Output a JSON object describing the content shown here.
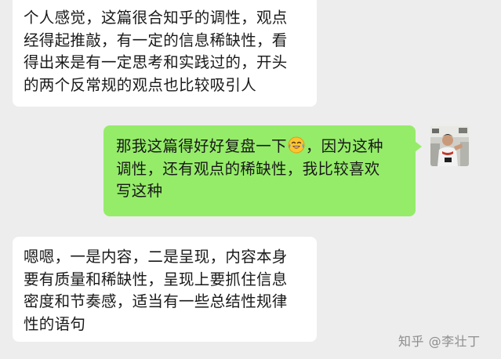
{
  "messages": [
    {
      "direction": "incoming",
      "lines": [
        "个人感觉，这篇很合知乎的调性，观点",
        "经得起推敲，有一定的信息稀缺性，看",
        "得出来是有一定思考和实践过的，开头",
        "的两个反常规的观点也比较吸引人"
      ]
    },
    {
      "direction": "outgoing",
      "line1_before_emoji": "那我这篇得好好复盘一下",
      "line1_after_emoji": "，因为这种",
      "lines_rest": [
        "调性，还有观点的稀缺性，我比较喜欢",
        "写这种"
      ],
      "emoji": "crying-laughing-face-icon"
    },
    {
      "direction": "incoming",
      "lines": [
        "嗯嗯，一是内容，二是呈现，内容本身",
        "要有质量和稀缺性，呈现上要抓住信息",
        "密度和节奏感，适当有一些总结性规律",
        "性的语句"
      ]
    }
  ],
  "watermark": "知乎 @李壮丁",
  "colors": {
    "background": "#ededed",
    "incoming_bubble": "#ffffff",
    "outgoing_bubble": "#95ec69",
    "text": "#191919",
    "watermark": "#8e8e8e"
  }
}
